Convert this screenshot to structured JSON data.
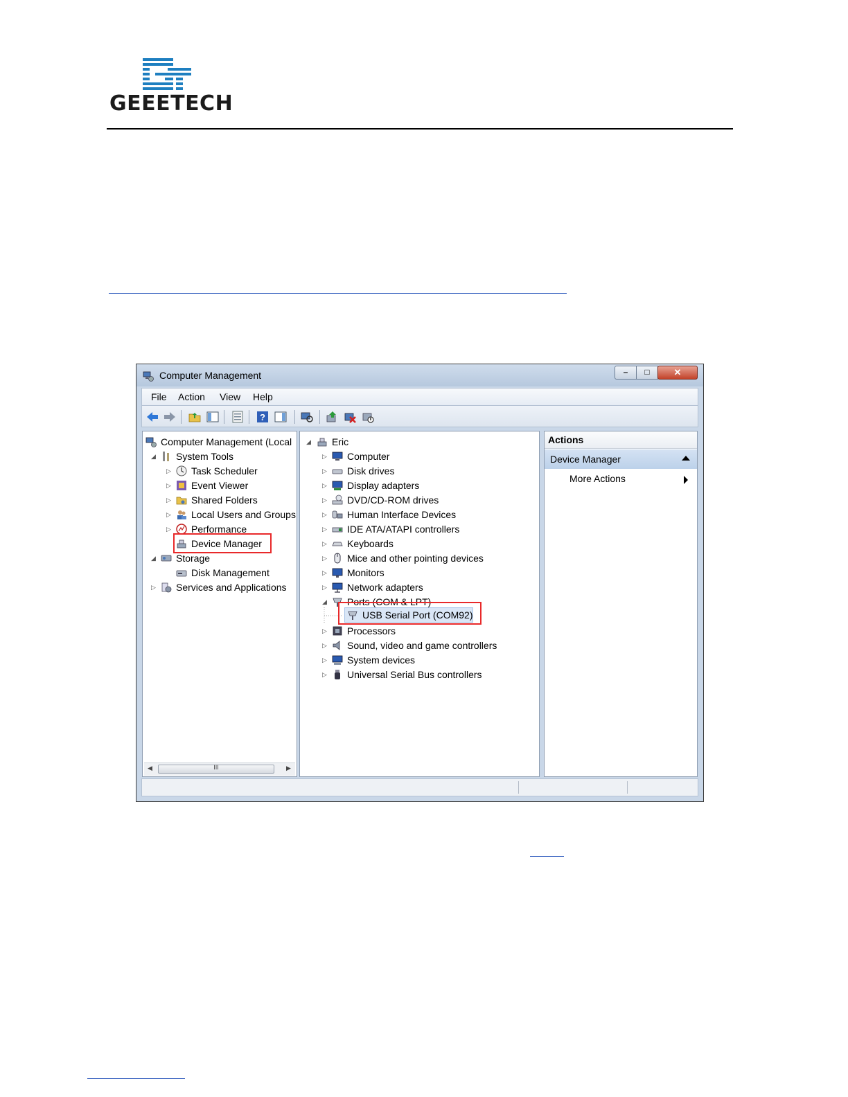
{
  "logo": {
    "text": "GEEETECH"
  },
  "window": {
    "title": "Computer Management",
    "menu": [
      "File",
      "Action",
      "View",
      "Help"
    ],
    "left_tree": [
      {
        "label": "Computer Management (Local",
        "icon": "computer-management-icon"
      },
      {
        "label": "System Tools",
        "icon": "system-tools-icon"
      },
      {
        "label": "Task Scheduler",
        "icon": "task-scheduler-icon"
      },
      {
        "label": "Event Viewer",
        "icon": "event-viewer-icon"
      },
      {
        "label": "Shared Folders",
        "icon": "shared-folders-icon"
      },
      {
        "label": "Local Users and Groups",
        "icon": "users-icon"
      },
      {
        "label": "Performance",
        "icon": "performance-icon"
      },
      {
        "label": "Device Manager",
        "icon": "device-manager-icon"
      },
      {
        "label": "Storage",
        "icon": "storage-icon"
      },
      {
        "label": "Disk Management",
        "icon": "disk-management-icon"
      },
      {
        "label": "Services and Applications",
        "icon": "services-icon"
      }
    ],
    "scroll_thumb": "III",
    "device_tree": [
      {
        "label": "Eric",
        "icon": "computer-icon"
      },
      {
        "label": "Computer",
        "icon": "computer-icon"
      },
      {
        "label": "Disk drives",
        "icon": "disk-drive-icon"
      },
      {
        "label": "Display adapters",
        "icon": "display-adapter-icon"
      },
      {
        "label": "DVD/CD-ROM drives",
        "icon": "dvd-drive-icon"
      },
      {
        "label": "Human Interface Devices",
        "icon": "hid-icon"
      },
      {
        "label": "IDE ATA/ATAPI controllers",
        "icon": "ide-controller-icon"
      },
      {
        "label": "Keyboards",
        "icon": "keyboard-icon"
      },
      {
        "label": "Mice and other pointing devices",
        "icon": "mouse-icon"
      },
      {
        "label": "Monitors",
        "icon": "monitor-icon"
      },
      {
        "label": "Network adapters",
        "icon": "network-adapter-icon"
      },
      {
        "label": "Ports (COM & LPT)",
        "icon": "port-icon"
      },
      {
        "label": "USB Serial Port (COM92)",
        "icon": "serial-port-icon"
      },
      {
        "label": "Processors",
        "icon": "processor-icon"
      },
      {
        "label": "Sound, video and game controllers",
        "icon": "sound-icon"
      },
      {
        "label": "System devices",
        "icon": "system-devices-icon"
      },
      {
        "label": "Universal Serial Bus controllers",
        "icon": "usb-icon"
      }
    ],
    "actions": {
      "header": "Actions",
      "section": "Device Manager",
      "more": "More Actions"
    },
    "colors": {
      "highlight": "#e8292a",
      "link": "#1f4fb8",
      "logo_blue": "#1e7fc0"
    }
  }
}
